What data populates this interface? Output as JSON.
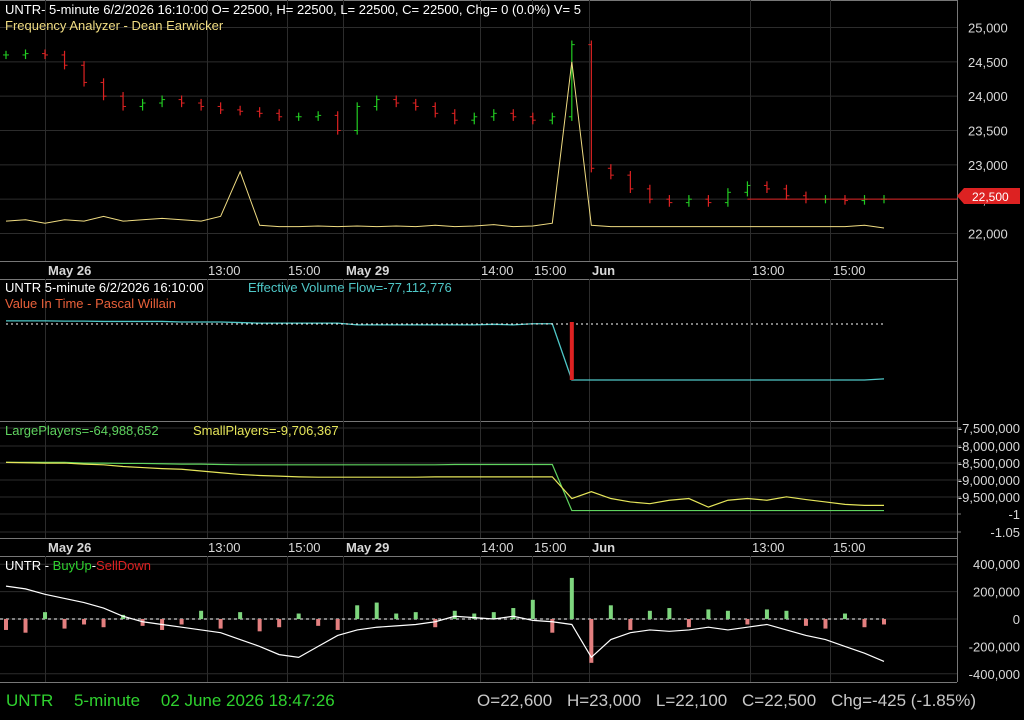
{
  "colors": {
    "background": "#000000",
    "grid": "#2c2c2c",
    "divider": "#777777",
    "text": "#ffffff",
    "axis_text": "#d8d8d8",
    "up": "#22cc22",
    "down": "#dd2222",
    "frequency": "#f0dc82",
    "evf": "#4fc8c8",
    "large": "#5fd35f",
    "small": "#e6e65a",
    "white_line": "#ffffff",
    "status_green": "#2fd22f",
    "status_gray": "#c8c8c8",
    "last_price_bg": "#dd2222"
  },
  "time_axis": {
    "labels": [
      "May 26",
      "13:00",
      "15:00",
      "May 29",
      "14:00",
      "15:00",
      "Jun",
      "13:00",
      "15:00"
    ],
    "bold": [
      true,
      false,
      false,
      true,
      false,
      false,
      true,
      false,
      false
    ]
  },
  "panels": {
    "price": {
      "header": "UNTR- 5-minute 6/2/2026 16:10:00 O= 22500, H= 22500, L= 22500, C= 22500, Chg= 0 (0.0%) V= 5",
      "subheader": "Frequency Analyzer - Dean Earwicker",
      "last_price": "22,500"
    },
    "volume_flow": {
      "title": "UNTR 5-minute  6/2/2026 16:10:00",
      "evf_label": "Effective Volume Flow=-77,112,776",
      "subtitle": "Value In Time - Pascal Willain"
    },
    "players": {
      "large_label": "LargePlayers=-64,988,652",
      "small_label": "SmallPlayers=-9,706,367"
    },
    "buy_sell": {
      "symbol": "UNTR",
      "sep1": " - ",
      "buy_label": "BuyUp",
      "sep2": "-",
      "sell_label": "SellDown"
    }
  },
  "status": {
    "symbol": "UNTR",
    "interval": "5-minute",
    "datetime": "02 June 2026 18:47:26",
    "open": "O=22,600",
    "high": "H=23,000",
    "low": "L=22,100",
    "close": "C=22,500",
    "change": "Chg=-425 (-1.85%)"
  },
  "chart_data": [
    {
      "type": "line",
      "name": "price",
      "title": "UNTR- 5-minute 6/2/2026 16:10:00 O= 22500, H= 22500, L= 22500, C= 22500, Chg= 0 (0.0%) V= 5",
      "ylim": [
        21600,
        25400
      ],
      "yticks": [
        22000,
        22500,
        23000,
        23500,
        24000,
        24500,
        25000
      ],
      "ytick_labels": [
        "22,000",
        "22,500",
        "23,000",
        "23,500",
        "24,000",
        "24,500",
        "25,000"
      ],
      "x": [
        "May 26",
        "13:00",
        "15:00",
        "May 29",
        "14:00",
        "15:00",
        "Jun",
        "13:00",
        "15:00"
      ],
      "close": [
        24600,
        24620,
        24600,
        24450,
        24200,
        24000,
        23850,
        23900,
        23950,
        23900,
        23850,
        23800,
        23780,
        23750,
        23700,
        23700,
        23720,
        23500,
        23850,
        23950,
        23900,
        23850,
        23750,
        23650,
        23700,
        23750,
        23700,
        23650,
        23700,
        24750,
        22950,
        22850,
        22650,
        22500,
        22450,
        22500,
        22450,
        22600,
        22700,
        22650,
        22550,
        22500,
        22500,
        22480,
        22500,
        22500
      ],
      "last": 22500,
      "frequency_analyzer": [
        22180,
        22200,
        22150,
        22200,
        22180,
        22250,
        22180,
        22200,
        22220,
        22200,
        22180,
        22250,
        22900,
        22120,
        22100,
        22100,
        22110,
        22100,
        22110,
        22100,
        22110,
        22100,
        22120,
        22100,
        22110,
        22130,
        22100,
        22110,
        22150,
        24500,
        22120,
        22100,
        22100,
        22100,
        22100,
        22100,
        22100,
        22100,
        22100,
        22100,
        22100,
        22100,
        22100,
        22100,
        22120,
        22080
      ]
    },
    {
      "type": "line",
      "name": "effective-volume-flow",
      "series": [
        {
          "name": "Effective Volume Flow",
          "values": [
            0.02,
            0.02,
            0.02,
            0.015,
            0.015,
            0.01,
            0.01,
            0.01,
            0.01,
            0.0,
            0.0,
            0.0,
            -0.01,
            -0.02,
            -0.02,
            -0.02,
            -0.02,
            -0.02,
            -0.05,
            -0.05,
            -0.05,
            -0.05,
            -0.05,
            -0.05,
            -0.05,
            -0.04,
            -0.05,
            -0.03,
            -0.03,
            -1.0,
            -1.0,
            -1.0,
            -1.0,
            -1.0,
            -1.0,
            -1.0,
            -1.0,
            -1.0,
            -1.0,
            -1.0,
            -1.0,
            -1.0,
            -1.0,
            -1.0,
            -1.0,
            -0.98
          ]
        }
      ]
    },
    {
      "type": "line",
      "name": "players",
      "ytick_labels": [
        "-7,500,000",
        "-8,000,000",
        "-8,500,000",
        "-9,000,000",
        "-9,500,000",
        "-1",
        "-1.05"
      ],
      "series": [
        {
          "name": "LargePlayers",
          "values": [
            -8.5,
            -8.5,
            -8.5,
            -8.5,
            -8.52,
            -8.52,
            -8.53,
            -8.53,
            -8.54,
            -8.55,
            -8.55,
            -8.56,
            -8.57,
            -8.57,
            -8.57,
            -8.57,
            -8.57,
            -8.57,
            -8.57,
            -8.57,
            -8.57,
            -8.57,
            -8.57,
            -8.56,
            -8.56,
            -8.56,
            -8.56,
            -8.56,
            -8.56,
            -9.9,
            -9.9,
            -9.9,
            -9.9,
            -9.9,
            -9.9,
            -9.9,
            -9.9,
            -9.9,
            -9.9,
            -9.9,
            -9.9,
            -9.9,
            -9.9,
            -9.9,
            -9.9,
            -9.9
          ]
        },
        {
          "name": "SmallPlayers",
          "values": [
            -8.5,
            -8.51,
            -8.52,
            -8.52,
            -8.55,
            -8.57,
            -8.62,
            -8.65,
            -8.68,
            -8.7,
            -8.75,
            -8.8,
            -8.85,
            -8.88,
            -8.9,
            -8.92,
            -8.93,
            -8.93,
            -8.93,
            -8.93,
            -8.93,
            -8.93,
            -8.92,
            -8.92,
            -8.92,
            -8.92,
            -8.92,
            -8.92,
            -8.92,
            -9.55,
            -9.35,
            -9.55,
            -9.65,
            -9.7,
            -9.6,
            -9.55,
            -9.8,
            -9.6,
            -9.55,
            -9.6,
            -9.5,
            -9.58,
            -9.65,
            -9.72,
            -9.75,
            -9.75
          ]
        }
      ]
    },
    {
      "type": "bar",
      "name": "buyup-selldown",
      "ylim": [
        -460000,
        460000
      ],
      "yticks": [
        -400000,
        -200000,
        0,
        200000,
        400000
      ],
      "ytick_labels": [
        "-400,000",
        "-200,000",
        "0",
        "200,000",
        "400,000"
      ],
      "values": [
        -80000,
        -100000,
        50000,
        -70000,
        -40000,
        -60000,
        30000,
        -50000,
        -80000,
        -40000,
        60000,
        -70000,
        50000,
        -90000,
        -60000,
        40000,
        -50000,
        -80000,
        100000,
        120000,
        40000,
        50000,
        -60000,
        60000,
        40000,
        50000,
        80000,
        140000,
        -100000,
        300000,
        -320000,
        100000,
        -80000,
        60000,
        80000,
        -60000,
        70000,
        60000,
        -40000,
        70000,
        60000,
        -50000,
        -70000,
        40000,
        -60000,
        -40000
      ],
      "cumulative": [
        240000,
        220000,
        180000,
        150000,
        120000,
        80000,
        20000,
        -20000,
        -40000,
        -60000,
        -80000,
        -100000,
        -150000,
        -200000,
        -260000,
        -280000,
        -200000,
        -120000,
        -80000,
        -60000,
        -50000,
        -40000,
        -20000,
        20000,
        10000,
        0,
        20000,
        -10000,
        -20000,
        -40000,
        -280000,
        -150000,
        -100000,
        -80000,
        -90000,
        -80000,
        -60000,
        -80000,
        -60000,
        -40000,
        -80000,
        -120000,
        -150000,
        -200000,
        -250000,
        -310000
      ]
    }
  ]
}
